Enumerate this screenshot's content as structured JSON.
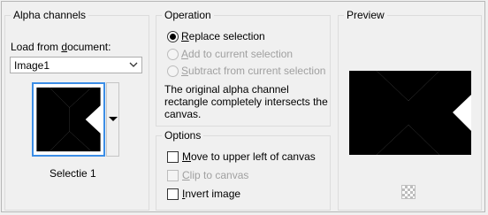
{
  "alpha_channels": {
    "title": "Alpha channels",
    "load_prefix": "Load from ",
    "load_access": "d",
    "load_suffix": "ocument:",
    "document_value": "Image1",
    "selection_name": "Selectie 1"
  },
  "operation": {
    "title": "Operation",
    "options": [
      {
        "access": "R",
        "rest": "eplace selection",
        "selected": true,
        "enabled": true
      },
      {
        "access": "A",
        "rest": "dd to current selection",
        "selected": false,
        "enabled": false
      },
      {
        "access": "S",
        "rest": "ubtract from current selection",
        "selected": false,
        "enabled": false
      }
    ],
    "description_line1": "The original alpha channel",
    "description_line2": "rectangle completely intersects the",
    "description_line3": "canvas."
  },
  "options": {
    "title": "Options",
    "items": [
      {
        "access": "M",
        "rest": "ove to upper left of canvas",
        "checked": false,
        "enabled": true
      },
      {
        "access": "C",
        "rest": "lip to canvas",
        "checked": false,
        "enabled": false
      },
      {
        "access": "I",
        "rest": "nvert image",
        "checked": false,
        "enabled": true
      }
    ]
  },
  "preview": {
    "title": "Preview"
  },
  "colors": {
    "focus_border": "#3c8ee6",
    "shape": "#000000"
  },
  "icons": {
    "dropdown": "chevron-down-icon",
    "thumbnail_menu": "triangle-down-icon",
    "checker": "transparency-checker-icon"
  }
}
